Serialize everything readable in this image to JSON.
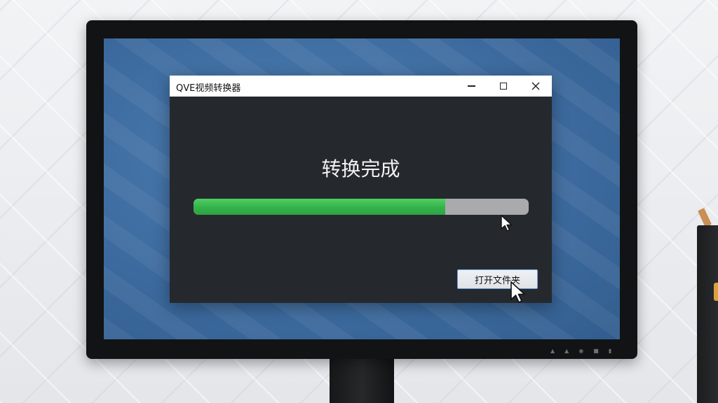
{
  "window": {
    "title": "QVE视频转换器",
    "controls": [
      "minimize-icon",
      "maximize-icon",
      "close-icon"
    ]
  },
  "main": {
    "status_text": "转换完成",
    "progress_fraction": 0.75,
    "open_folder_label": "打开文件夹"
  },
  "colors": {
    "progress_fill": "#3cbf52",
    "progress_track": "#a9aaad",
    "window_bg": "#25292e",
    "desktop_bg": "#3f6fa3"
  },
  "icons": {
    "cursor_1": "cursor-arrow-icon",
    "cursor_2": "cursor-arrow-icon"
  }
}
